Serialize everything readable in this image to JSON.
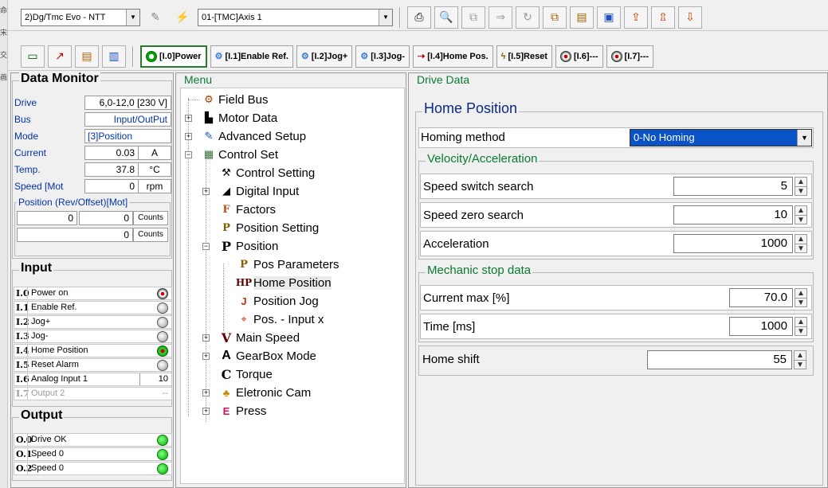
{
  "side_chars": [
    "命",
    "宋",
    "交",
    "画"
  ],
  "toolbar1": {
    "device_combo": "2)Dg/Tmc Evo - NTT",
    "axis_combo": "01-[TMC]Axis 1"
  },
  "toolbar2": {
    "inputs": [
      {
        "label": "[I.0]Power",
        "icon": "power-indicator-icon"
      },
      {
        "label": "[I.1]Enable Ref.",
        "icon": "gear-icon"
      },
      {
        "label": "[I.2]Jog+",
        "icon": "gear-icon"
      },
      {
        "label": "[I.3]Jog-",
        "icon": "gear-icon"
      },
      {
        "label": "[I.4]Home Pos.",
        "icon": "home-arrow-icon"
      },
      {
        "label": "[I.5]Reset",
        "icon": "reset-icon"
      },
      {
        "label": "[I.6]---",
        "icon": "indicator-icon"
      },
      {
        "label": "[I.7]---",
        "icon": "indicator-icon"
      }
    ]
  },
  "data_monitor": {
    "title": "Data Monitor",
    "rows": [
      {
        "label": "Drive",
        "value": "6,0-12,0 [230 V]",
        "unit": ""
      },
      {
        "label": "Bus",
        "value": "Input/OutPut",
        "unit": ""
      },
      {
        "label": "Mode",
        "value": "[3]Position",
        "unit": ""
      },
      {
        "label": "Current",
        "value": "0.03",
        "unit": "A"
      },
      {
        "label": "Temp.",
        "value": "37.8",
        "unit": "°C"
      },
      {
        "label": "Speed [Mot",
        "value": "0",
        "unit": "rpm"
      }
    ],
    "position_group": "Position (Rev/Offset)[Mot]",
    "position_rev": "0",
    "position_offset": "0",
    "position_offset_unit": "Counts",
    "position_total": "0",
    "position_total_unit": "Counts"
  },
  "input": {
    "title": "Input",
    "items": [
      {
        "code": "I.0",
        "name": "Power on",
        "state": "red"
      },
      {
        "code": "I.1",
        "name": "Enable Ref.",
        "state": "grey"
      },
      {
        "code": "I.2",
        "name": "Jog+",
        "state": "grey"
      },
      {
        "code": "I.3",
        "name": "Jog-",
        "state": "grey"
      },
      {
        "code": "I.4",
        "name": "Home Position",
        "state": "green-red"
      },
      {
        "code": "I.5",
        "name": "Reset Alarm",
        "state": "grey"
      },
      {
        "code": "I.6",
        "name": "Analog Input 1",
        "value": "10"
      },
      {
        "code": "I.7",
        "name": "Output 2",
        "value": "--"
      }
    ]
  },
  "output": {
    "title": "Output",
    "items": [
      {
        "code": "O.0",
        "name": "Drive OK"
      },
      {
        "code": "O.1",
        "name": "Speed 0"
      },
      {
        "code": "O.2",
        "name": "Speed 0"
      }
    ]
  },
  "menu": {
    "title": "Menu",
    "items": [
      {
        "label": "Field Bus",
        "icon": "field-bus-icon",
        "glyph": "⚙"
      },
      {
        "label": "Motor Data",
        "icon": "motor-icon",
        "glyph": "▙"
      },
      {
        "label": "Advanced Setup",
        "icon": "wrench-icon",
        "glyph": "✎"
      },
      {
        "label": "Control Set",
        "icon": "control-set-icon",
        "glyph": "▦"
      },
      {
        "label": "Control Setting",
        "icon": "control-setting-icon",
        "glyph": "⚒"
      },
      {
        "label": "Digital Input",
        "icon": "digital-input-icon",
        "glyph": "◢"
      },
      {
        "label": "Factors",
        "icon": "factors-icon",
        "glyph": "F"
      },
      {
        "label": "Position Setting",
        "icon": "position-setting-icon",
        "glyph": "P"
      },
      {
        "label": "Position",
        "icon": "position-icon",
        "glyph": "P"
      },
      {
        "label": "Pos Parameters",
        "icon": "pos-parameters-icon",
        "glyph": "P"
      },
      {
        "label": "Home Position",
        "icon": "home-position-icon",
        "glyph": "HP"
      },
      {
        "label": "Position Jog",
        "icon": "position-jog-icon",
        "glyph": "J"
      },
      {
        "label": "Pos. - Input x",
        "icon": "pos-input-icon",
        "glyph": "⌖"
      },
      {
        "label": "Main Speed",
        "icon": "main-speed-icon",
        "glyph": "V"
      },
      {
        "label": "GearBox Mode",
        "icon": "gearbox-icon",
        "glyph": "A"
      },
      {
        "label": "Torque",
        "icon": "torque-icon",
        "glyph": "C"
      },
      {
        "label": "Eletronic Cam",
        "icon": "cam-icon",
        "glyph": "♣"
      },
      {
        "label": "Press",
        "icon": "press-icon",
        "glyph": "E"
      }
    ]
  },
  "drive_data": {
    "title": "Drive Data",
    "home_position_title": "Home Position",
    "homing_method_label": "Homing method",
    "homing_method_value": "0-No Homing",
    "velocity_title": "Velocity/Acceleration",
    "speed_switch_label": "Speed switch search",
    "speed_switch_value": "5",
    "speed_zero_label": "Speed zero search",
    "speed_zero_value": "10",
    "acceleration_label": "Acceleration",
    "acceleration_value": "1000",
    "mechanic_title": "Mechanic stop data",
    "current_max_label": "Current max [%]",
    "current_max_value": "70.0",
    "time_label": "Time [ms]",
    "time_value": "1000",
    "home_shift_label": "Home shift",
    "home_shift_value": "55"
  },
  "colors": {
    "label_blue": "#0033aa",
    "selection_blue": "#0a53c7",
    "led_green": "#00b000",
    "led_red": "#c00000"
  }
}
